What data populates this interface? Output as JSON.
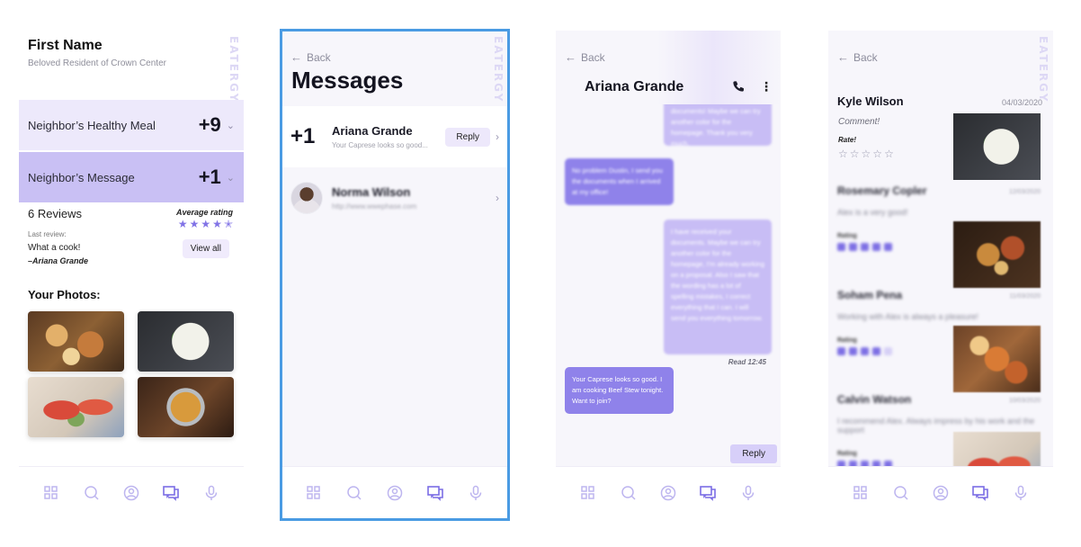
{
  "brand": "EATERGY",
  "nav_icons": [
    "grid-icon",
    "search-icon",
    "profile-icon",
    "messages-icon",
    "microphone-icon"
  ],
  "colors": {
    "accent": "#8173e6",
    "light_purple": "#ede9fb",
    "selected_outline": "#4a9be3"
  },
  "profile": {
    "name": "First Name",
    "subtitle": "Beloved Resident of Crown Center",
    "rows": [
      {
        "label": "Neighbor’s Healthy Meal",
        "count": "+9"
      },
      {
        "label": "Neighbor’s Message",
        "count": "+1"
      }
    ],
    "reviews_count": "6 Reviews",
    "average_label": "Average rating",
    "average_rating": 4.5,
    "last_review_label": "Last review:",
    "last_review_text": "What a cook!",
    "last_review_author": "–Ariana Grande",
    "view_all": "View all",
    "photos_title": "Your Photos:"
  },
  "messages": {
    "back": "Back",
    "title": "Messages",
    "threads": [
      {
        "count": "+1",
        "name": "Ariana Grande",
        "preview": "Your Caprese looks so good...",
        "action": "Reply"
      },
      {
        "name": "Norma Wilson",
        "preview": "http://www.wwephase.com"
      }
    ]
  },
  "chat": {
    "back": "Back",
    "contact": "Ariana Grande",
    "bubbles": [
      "documents! Maybe we can try another color for the homepage. Thank you very much.",
      "No problem Dustin, I send you the documents when I arrived at my office!",
      "I have received your documents. Maybe we can try another color for the homepage, I'm already working on a proposal. Also I saw that the wording has a lot of spelling mistakes, I correct everything that I can. I will send you everything tomorrow.",
      "Your Caprese looks so good. I am cooking Beef Stew tonight. Want to join?"
    ],
    "read_status": "Read 12:45",
    "reply": "Reply"
  },
  "reviews": {
    "back": "Back",
    "main": {
      "name": "Kyle Wilson",
      "date": "04/03/2020",
      "comment": "Comment!",
      "rate_label": "Rate!",
      "stars": 5
    },
    "others": [
      {
        "name": "Rosemary Copler",
        "text": "Alex is a very good!",
        "rating_label": "Rating",
        "stars": 5,
        "date": "12/03/2020"
      },
      {
        "name": "Soham Pena",
        "text": "Working with Alex is always a pleasure!",
        "rating_label": "Rating",
        "stars": 4,
        "date": "11/03/2020"
      },
      {
        "name": "Calvin Watson",
        "text": "I recommend Alex. Always impress by his work and the support",
        "rating_label": "Rating",
        "stars": 5,
        "date": "10/03/2020"
      }
    ]
  }
}
